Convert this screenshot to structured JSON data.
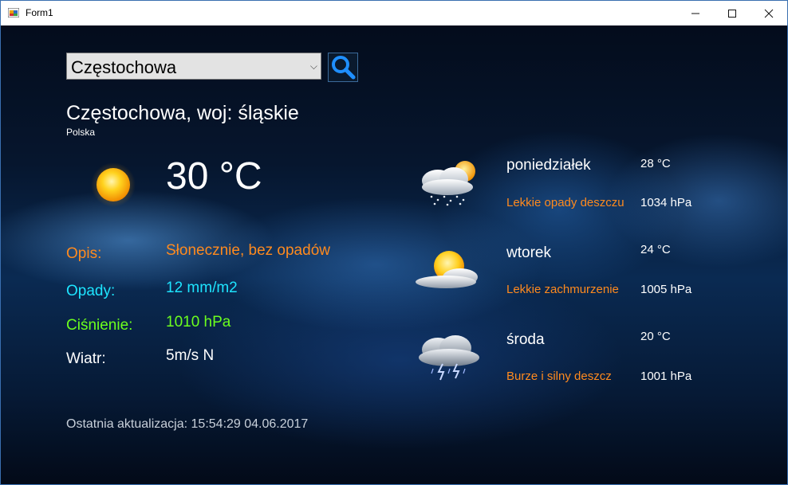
{
  "window": {
    "title": "Form1",
    "minimize_icon": "minimize-icon",
    "maximize_icon": "maximize-icon",
    "close_icon": "close-icon"
  },
  "search": {
    "city_value": "Częstochowa",
    "button_icon": "magnifier-icon"
  },
  "location": {
    "title": "Częstochowa, woj: śląskie",
    "country": "Polska"
  },
  "current": {
    "icon": "sun-icon",
    "temperature": "30 °C",
    "description_label": "Opis:",
    "description_value": "Słonecznie, bez opadów",
    "precip_label": "Opady:",
    "precip_value": "12 mm/m2",
    "pressure_label": "Ciśnienie:",
    "pressure_value": "1010 hPa",
    "wind_label": "Wiatr:",
    "wind_value": "5m/s N"
  },
  "last_update": "Ostatnia aktualizacja: 15:54:29  04.06.2017",
  "forecast": [
    {
      "day": "poniedziałek",
      "temp": "28 °C",
      "desc": "Lekkie opady deszczu",
      "pressure": "1034 hPa",
      "icon": "rain-cloud-sun-icon"
    },
    {
      "day": "wtorek",
      "temp": "24 °C",
      "desc": "Lekkie zachmurzenie",
      "pressure": "1005 hPa",
      "icon": "partly-cloudy-icon"
    },
    {
      "day": "środa",
      "temp": "20 °C",
      "desc": "Burze i silny deszcz",
      "pressure": "1001 hPa",
      "icon": "thunderstorm-icon"
    }
  ],
  "colors": {
    "desc_label": "#ff8a1e",
    "precip_label": "#1ee4ff",
    "pressure_label": "#6cff1e",
    "wind_label": "#ffffff"
  }
}
